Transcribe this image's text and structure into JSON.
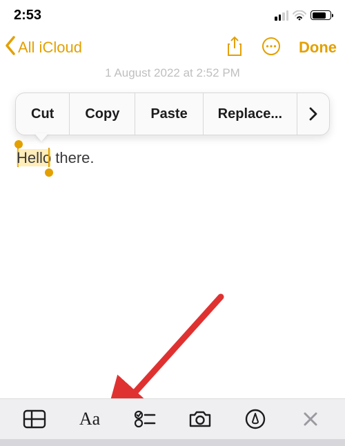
{
  "status": {
    "time": "2:53"
  },
  "nav": {
    "back_label": "All iCloud",
    "done_label": "Done"
  },
  "faded_date_text": "1 August 2022 at 2:52 PM",
  "menu": {
    "cut": "Cut",
    "copy": "Copy",
    "paste": "Paste",
    "replace": "Replace..."
  },
  "note": {
    "selected_word": "Hello",
    "remaining": " there."
  },
  "toolbar": {
    "text_button_glyph": "Aa"
  },
  "colors": {
    "accent": "#e3a000",
    "arrow": "#e03131"
  }
}
